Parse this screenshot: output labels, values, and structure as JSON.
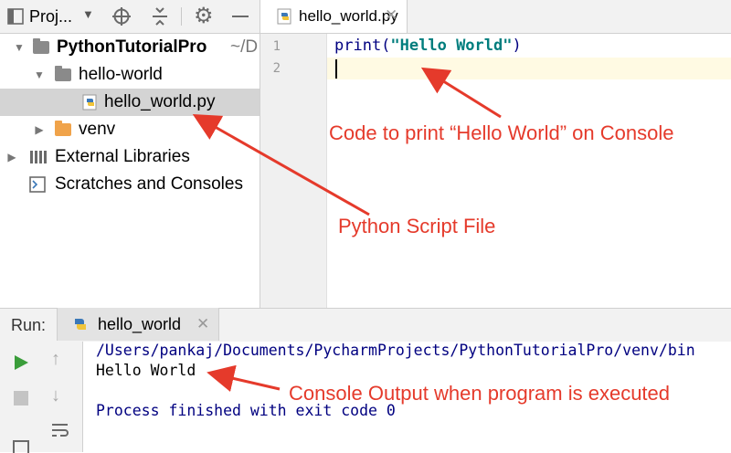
{
  "project_panel": {
    "title": "Proj...",
    "tree": [
      {
        "label": "PythonTutorialPro",
        "suffix": "~/D"
      },
      {
        "label": "hello-world"
      },
      {
        "label": "hello_world.py"
      },
      {
        "label": "venv"
      },
      {
        "label": "External Libraries"
      },
      {
        "label": "Scratches and Consoles"
      }
    ]
  },
  "editor": {
    "tab_label": "hello_world.py",
    "line_numbers": [
      "1",
      "2"
    ],
    "code": {
      "func": "print(",
      "string": "\"Hello World\"",
      "close": ")"
    }
  },
  "run_panel": {
    "label": "Run:",
    "tab_label": "hello_world",
    "console": [
      "/Users/pankaj/Documents/PycharmProjects/PythonTutorialPro/venv/bin",
      "Hello World",
      "",
      "Process finished with exit code 0"
    ]
  },
  "annotations": {
    "code_note": "Code to print “Hello World” on Console",
    "file_note": "Python Script File",
    "console_note": "Console Output when program is executed"
  },
  "colors": {
    "annotation": "#e53a2b",
    "folder_gray": "#8a8a8a",
    "folder_orange": "#f0a34a",
    "code_blue": "#000080",
    "string_green": "#007d7d"
  }
}
